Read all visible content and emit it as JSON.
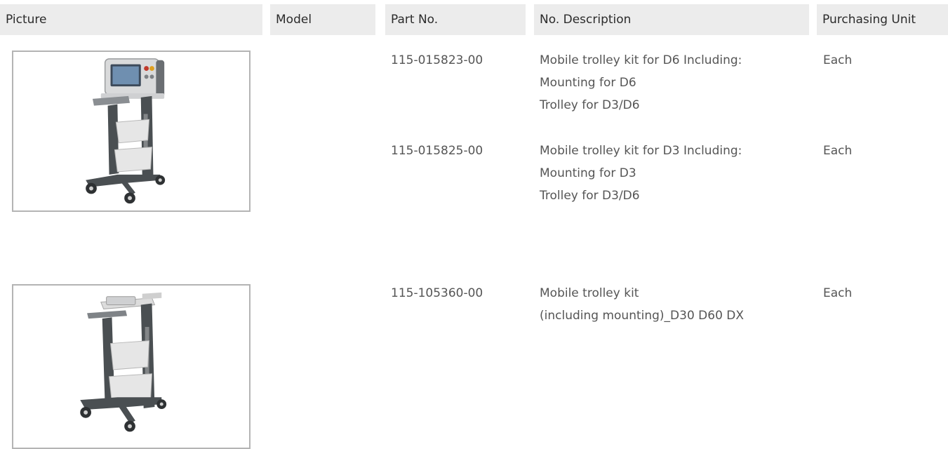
{
  "header": {
    "picture": "Picture",
    "model": "Model",
    "part_no": "Part No.",
    "description": "No. Description",
    "purchasing_unit": "Purchasing Unit"
  },
  "rows": [
    {
      "part_no": "115-015823-00",
      "description": [
        "Mobile trolley kit for D6  Including:",
        "Mounting for D6",
        "Trolley for D3/D6"
      ],
      "unit": "Each"
    },
    {
      "part_no": "115-015825-00",
      "description": [
        "Mobile trolley kit for D3  Including:",
        "Mounting for D3",
        "Trolley for D3/D6"
      ],
      "unit": "Each"
    },
    {
      "part_no": "115-105360-00",
      "description": [
        "Mobile trolley kit",
        "(including mounting)_D30 D60 DX"
      ],
      "unit": "Each"
    }
  ],
  "pictures": [
    {
      "icon": "trolley-with-defibrillator-image"
    },
    {
      "icon": "trolley-with-mounting-image"
    }
  ],
  "colors": {
    "header_bg": "#ececec",
    "header_text": "#2b2b2b",
    "body_text": "#555555",
    "frame_border": "#b4b4b4",
    "trolley_dark": "#4a4f52",
    "trolley_light": "#e6e6e6"
  }
}
